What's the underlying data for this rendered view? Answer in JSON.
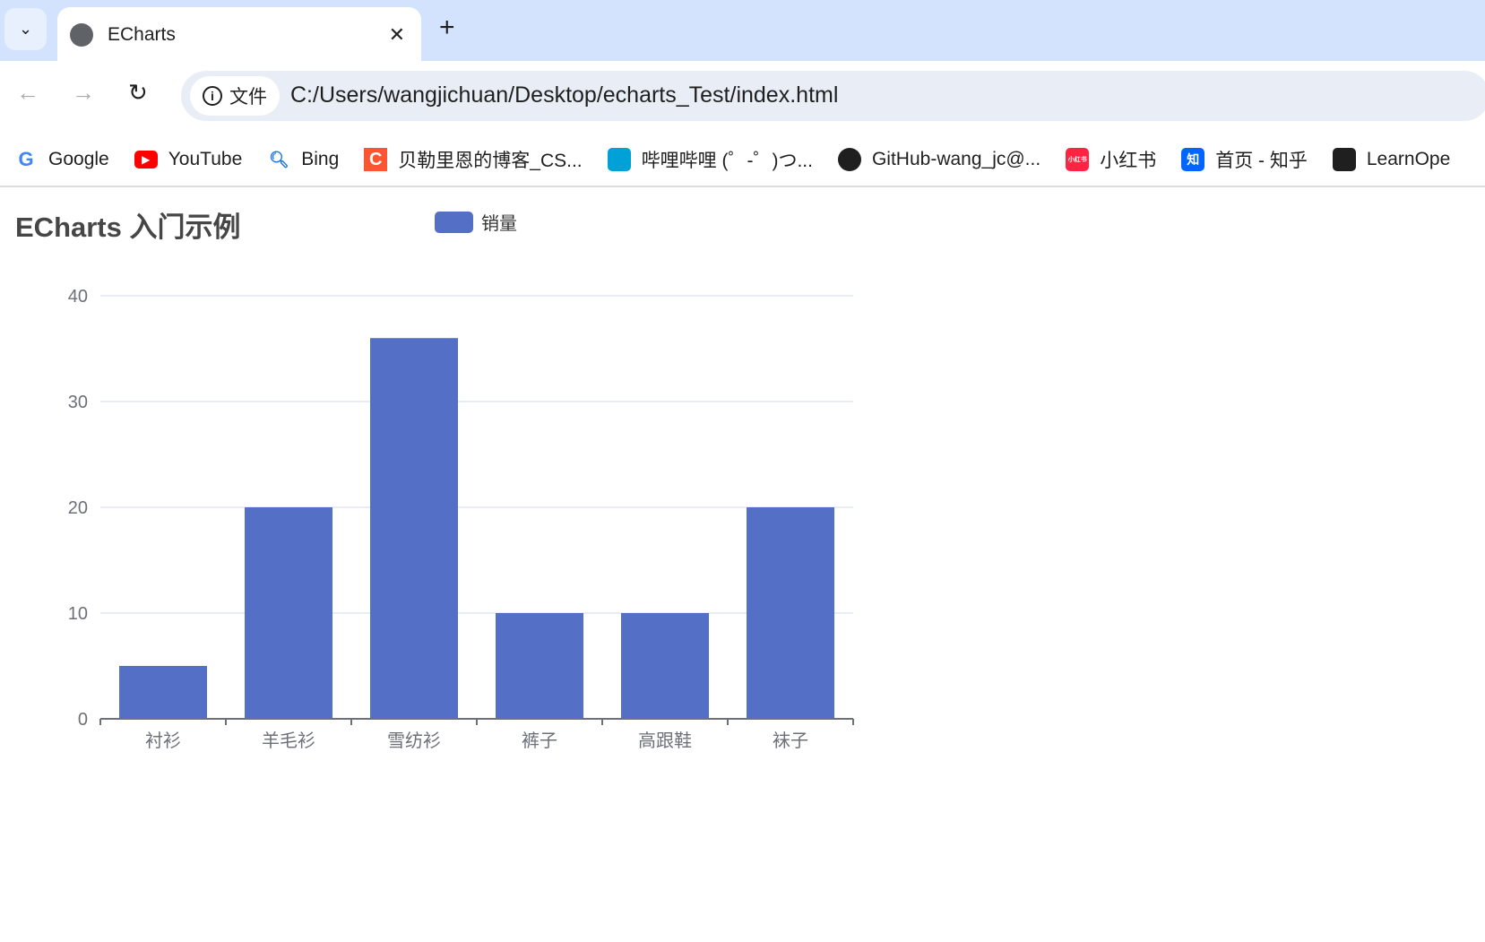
{
  "browser": {
    "tab_title": "ECharts",
    "address_chip": "文件",
    "url": "C:/Users/wangjichuan/Desktop/echarts_Test/index.html",
    "bookmarks": [
      {
        "label": "Google",
        "icon": "google-icon",
        "color": "#4285f4"
      },
      {
        "label": "YouTube",
        "icon": "youtube-icon",
        "color": "#ff0000"
      },
      {
        "label": "Bing",
        "icon": "search-icon",
        "color": "#ffffff"
      },
      {
        "label": "贝勒里恩的博客_CS...",
        "icon": "csdn-icon",
        "color": "#fc5531"
      },
      {
        "label": "哔哩哔哩 (゜-゜)つ...",
        "icon": "bilibili-icon",
        "color": "#00a1d6"
      },
      {
        "label": "GitHub-wang_jc@...",
        "icon": "github-icon",
        "color": "#1f1f1f"
      },
      {
        "label": "小红书",
        "icon": "xiaohongshu-icon",
        "color": "#ff2442"
      },
      {
        "label": "首页 - 知乎",
        "icon": "zhihu-icon",
        "color": "#0066ff"
      },
      {
        "label": "LearnOpe",
        "icon": "book-icon",
        "color": "#1f1f1f"
      }
    ]
  },
  "chart_data": {
    "type": "bar",
    "title": "ECharts 入门示例",
    "legend": [
      "销量"
    ],
    "legend_placement": "top-center",
    "categories": [
      "衬衫",
      "羊毛衫",
      "雪纺衫",
      "裤子",
      "高跟鞋",
      "袜子"
    ],
    "series": [
      {
        "name": "销量",
        "values": [
          5,
          20,
          36,
          10,
          10,
          20
        ],
        "color": "#5470c6"
      }
    ],
    "ylim": [
      0,
      40
    ],
    "yticks": [
      "0",
      "10",
      "20",
      "30",
      "40"
    ],
    "grid": true
  }
}
